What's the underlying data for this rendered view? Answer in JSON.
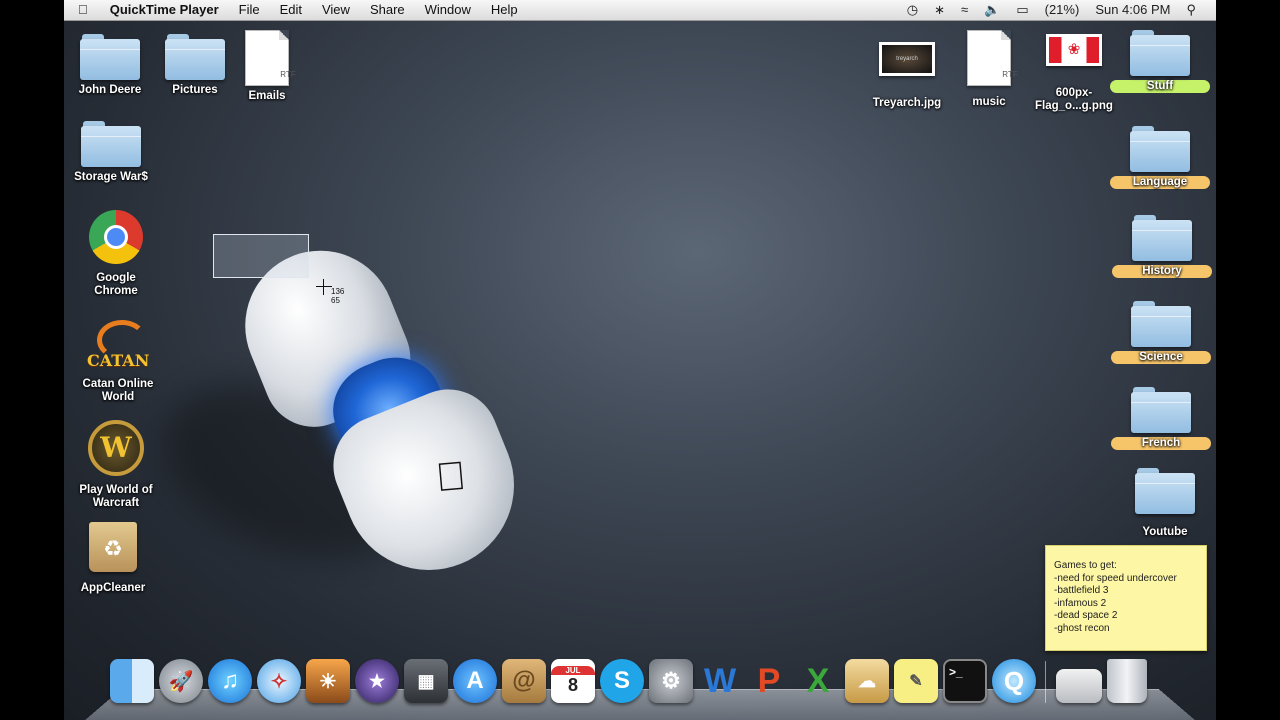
{
  "menubar": {
    "app_name": "QuickTime Player",
    "menus": [
      "File",
      "Edit",
      "View",
      "Share",
      "Window",
      "Help"
    ],
    "status": {
      "icons": [
        "time-machine-icon",
        "bluetooth-icon",
        "wifi-icon",
        "volume-icon",
        "battery-icon"
      ],
      "battery_percent": "(21%)",
      "clock": "Sun 4:06 PM"
    }
  },
  "desktop": {
    "left_icons": [
      {
        "label": "John Deere",
        "kind": "folder"
      },
      {
        "label": "Pictures",
        "kind": "folder"
      },
      {
        "label": "Emails",
        "kind": "rtf"
      },
      {
        "label": "Storage War$",
        "kind": "folder"
      },
      {
        "label": "Google\nChrome",
        "kind": "app"
      },
      {
        "label": "Catan Online\nWorld",
        "kind": "app"
      },
      {
        "label": "Play World of\nWarcraft",
        "kind": "alias"
      },
      {
        "label": "AppCleaner",
        "kind": "app"
      }
    ],
    "top_right_icons": [
      {
        "label": "Treyarch.jpg",
        "kind": "image",
        "thumb_text": "treyarch"
      },
      {
        "label": "music",
        "kind": "rtf"
      },
      {
        "label": "600px-\nFlag_o...g.png",
        "kind": "image"
      }
    ],
    "rtf_badge": "RTF",
    "catan_logo_text": "CATAN",
    "wow_logo_text": "W",
    "right_folders": [
      {
        "label": "Stuff",
        "tag_color": "#c6f26a"
      },
      {
        "label": "Language",
        "tag_color": "#f6c56a"
      },
      {
        "label": "History",
        "tag_color": "#f6c56a"
      },
      {
        "label": "Science",
        "tag_color": "#f6c56a"
      },
      {
        "label": "French",
        "tag_color": "#f6c56a"
      },
      {
        "label": "Youtube",
        "tag_color": ""
      }
    ]
  },
  "selection": {
    "coord_x": "136",
    "coord_y": "65"
  },
  "sticky": {
    "lines": [
      "Games to get:",
      "-need for speed undercover",
      "-battlefield 3",
      "-infamous 2",
      "-dead space 2",
      "-ghost recon"
    ]
  },
  "dock": {
    "items": [
      "finder-icon",
      "launchpad-icon",
      "itunes-icon",
      "safari-icon",
      "iphoto-icon",
      "dashboard-icon",
      "image-capture-icon",
      "app-store-icon",
      "address-book-icon",
      "ical-icon",
      "skype-icon",
      "system-preferences-icon",
      "word-icon",
      "powerpoint-icon",
      "excel-icon",
      "preview-icon",
      "stickies-icon",
      "terminal-icon",
      "quicktime-icon"
    ],
    "ical_month": "JUL",
    "ical_day": "8",
    "terminal_prompt": ">_"
  }
}
